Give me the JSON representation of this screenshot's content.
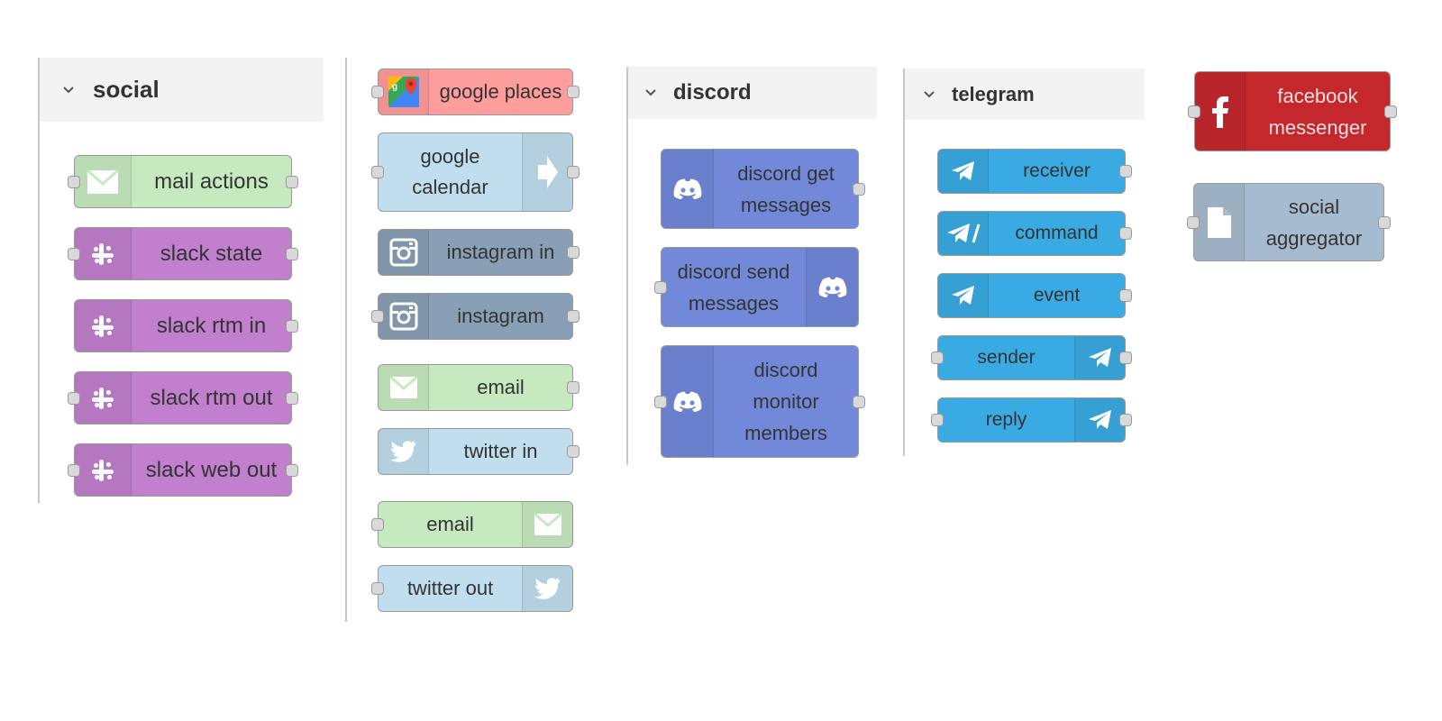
{
  "categories": {
    "social": {
      "title": "social",
      "nodes": {
        "mail_actions": "mail actions",
        "slack_state": "slack state",
        "slack_rtm_in": "slack rtm in",
        "slack_rtm_out": "slack rtm out",
        "slack_web_out": "slack web out"
      }
    },
    "misc": {
      "nodes": {
        "google_places": "google places",
        "google_calendar": "google\ncalendar",
        "instagram_in": "instagram in",
        "instagram": "instagram",
        "email_in": "email",
        "twitter_in": "twitter in",
        "email_out": "email",
        "twitter_out": "twitter out"
      }
    },
    "discord": {
      "title": "discord",
      "nodes": {
        "get_messages": "discord get\nmessages",
        "send_messages": "discord send\nmessages",
        "monitor_members": "discord\nmonitor\nmembers"
      }
    },
    "telegram": {
      "title": "telegram",
      "nodes": {
        "receiver": "receiver",
        "command": "command",
        "event": "event",
        "sender": "sender",
        "reply": "reply"
      }
    },
    "other": {
      "nodes": {
        "facebook_messenger": "facebook\nmessenger",
        "social_aggregator": "social\naggregator"
      }
    }
  },
  "colors": {
    "mail": "#c7e9c0",
    "slack": "#c27fce",
    "google_places": "#ff9c9c",
    "google_calendar": "#c0deed",
    "instagram": "#889fb5",
    "twitter": "#c0deed",
    "discord": "#7289da",
    "telegram": "#3aaae2",
    "facebook": "#c4282d",
    "aggregator": "#a6bbcf"
  },
  "icons": {
    "mail": "envelope-icon",
    "slack": "slack-icon",
    "google_places": "google-maps-icon",
    "google_calendar": "arrow-right-icon",
    "instagram": "instagram-icon",
    "twitter": "twitter-icon",
    "discord": "discord-icon",
    "telegram": "telegram-icon",
    "telegram_command": "telegram-command-icon",
    "facebook": "facebook-icon",
    "file": "file-icon"
  }
}
